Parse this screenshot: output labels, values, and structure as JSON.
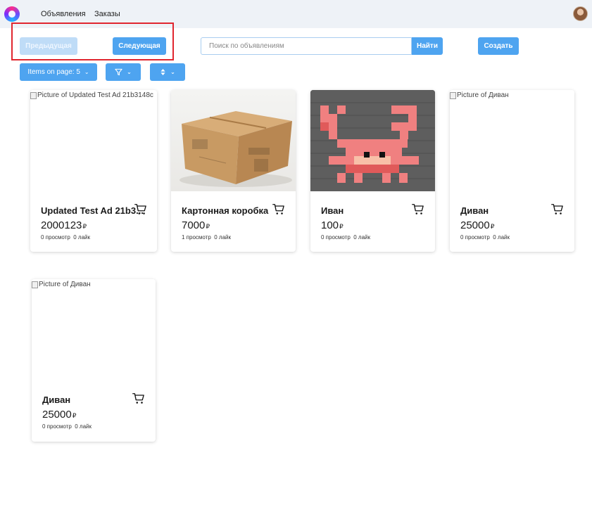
{
  "nav": {
    "links": [
      "Объявления",
      "Заказы"
    ]
  },
  "toolbar": {
    "prev_label": "Предыдущая",
    "next_label": "Следующая",
    "search_placeholder": "Поиск по объявлениям",
    "search_button": "Найти",
    "create_button": "Создать",
    "items_per_page_label": "Items on page: 5"
  },
  "colors": {
    "accent": "#4ea4f0",
    "accent_disabled": "#bfdcf7",
    "highlight": "#e0262f",
    "nav_bg": "#eef2f7"
  },
  "icons": [
    "filter-icon",
    "sort-icon",
    "chevron-down-icon",
    "cart-icon"
  ],
  "ads": [
    {
      "image_alt": "Picture of Updated Test Ad 21b3148c",
      "title": "Updated Test Ad 21b3...",
      "price": "2000123",
      "currency": "₽",
      "views": "0 просмотр",
      "likes": "0 лайк"
    },
    {
      "image_alt": "",
      "title": "Картонная коробка",
      "price": "7000",
      "currency": "₽",
      "views": "1 просмотр",
      "likes": "0 лайк"
    },
    {
      "image_alt": "",
      "title": "Иван",
      "price": "100",
      "currency": "₽",
      "views": "0 просмотр",
      "likes": "0 лайк"
    },
    {
      "image_alt": "Picture of Диван",
      "title": "Диван",
      "price": "25000",
      "currency": "₽",
      "views": "0 просмотр",
      "likes": "0 лайк"
    },
    {
      "image_alt": "Picture of Диван",
      "title": "Диван",
      "price": "25000",
      "currency": "₽",
      "views": "0 просмотр",
      "likes": "0 лайк"
    }
  ]
}
